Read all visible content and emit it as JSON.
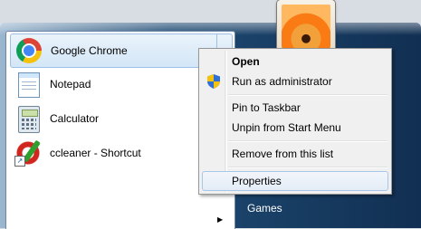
{
  "programs": [
    {
      "label": "Google Chrome",
      "icon": "chrome-icon"
    },
    {
      "label": "Notepad",
      "icon": "notepad-icon"
    },
    {
      "label": "Calculator",
      "icon": "calculator-icon"
    },
    {
      "label": "ccleaner - Shortcut",
      "icon": "ccleaner-icon"
    }
  ],
  "right_panel": {
    "games_label": "Games"
  },
  "context_menu": {
    "items": [
      {
        "label": "Open"
      },
      {
        "label": "Run as administrator",
        "icon": "uac-shield-icon"
      },
      {
        "label": "Pin to Taskbar"
      },
      {
        "label": "Unpin from Start Menu"
      },
      {
        "label": "Remove from this list"
      },
      {
        "label": "Properties"
      }
    ]
  },
  "colors": {
    "hover_fill": "#d3e6f7",
    "hover_border": "#9ec0e4",
    "menu_bg": "#f0f0f0",
    "frame_dark": "#1e4a73"
  }
}
